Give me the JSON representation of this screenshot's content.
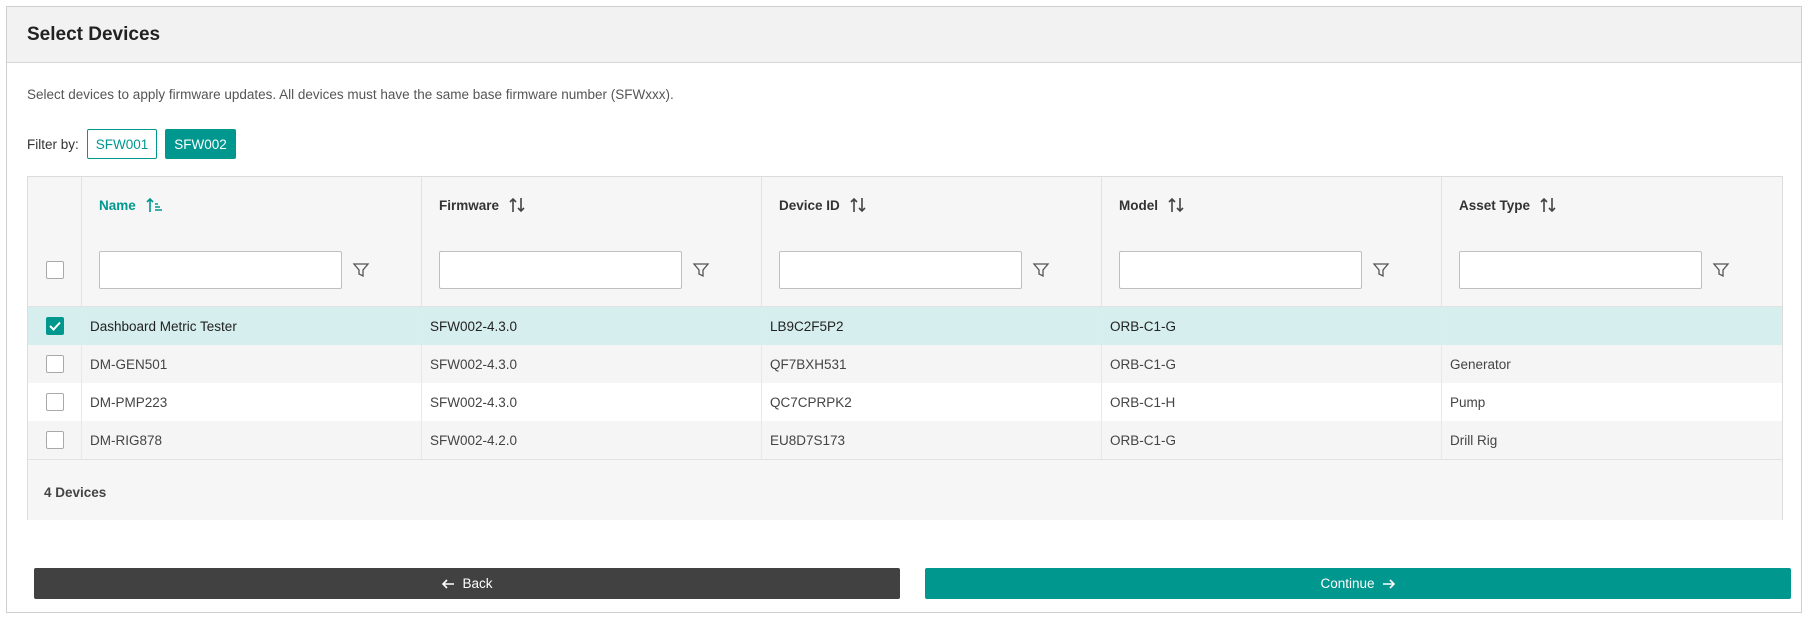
{
  "panel": {
    "title": "Select Devices",
    "description": "Select devices to apply firmware updates. All devices must have the same base firmware number (SFWxxx)."
  },
  "filter": {
    "label": "Filter by:",
    "chips": [
      "SFW001",
      "SFW002"
    ],
    "active": "SFW002"
  },
  "table": {
    "columns": [
      "Name",
      "Firmware",
      "Device ID",
      "Model",
      "Asset Type"
    ],
    "sorted_column": "Name",
    "rows": [
      {
        "name": "Dashboard Metric Tester",
        "firmware": "SFW002-4.3.0",
        "device_id": "LB9C2F5P2",
        "model": "ORB-C1-G",
        "asset_type": "",
        "selected": true
      },
      {
        "name": "DM-GEN501",
        "firmware": "SFW002-4.3.0",
        "device_id": "QF7BXH531",
        "model": "ORB-C1-G",
        "asset_type": "Generator",
        "selected": false
      },
      {
        "name": "DM-PMP223",
        "firmware": "SFW002-4.3.0",
        "device_id": "QC7CPRPK2",
        "model": "ORB-C1-H",
        "asset_type": "Pump",
        "selected": false
      },
      {
        "name": "DM-RIG878",
        "firmware": "SFW002-4.2.0",
        "device_id": "EU8D7S173",
        "model": "ORB-C1-G",
        "asset_type": "Drill Rig",
        "selected": false
      }
    ],
    "footer": "4 Devices"
  },
  "buttons": {
    "back": "Back",
    "continue": "Continue"
  },
  "colors": {
    "accent": "#00978f",
    "selected_row": "#d6eeee",
    "back_button": "#414141"
  },
  "icons": {
    "sort_active": "sort-ascending-icon",
    "sort": "sort-icon",
    "filter": "funnel-icon",
    "back": "arrow-left-icon",
    "continue": "arrow-right-icon"
  }
}
